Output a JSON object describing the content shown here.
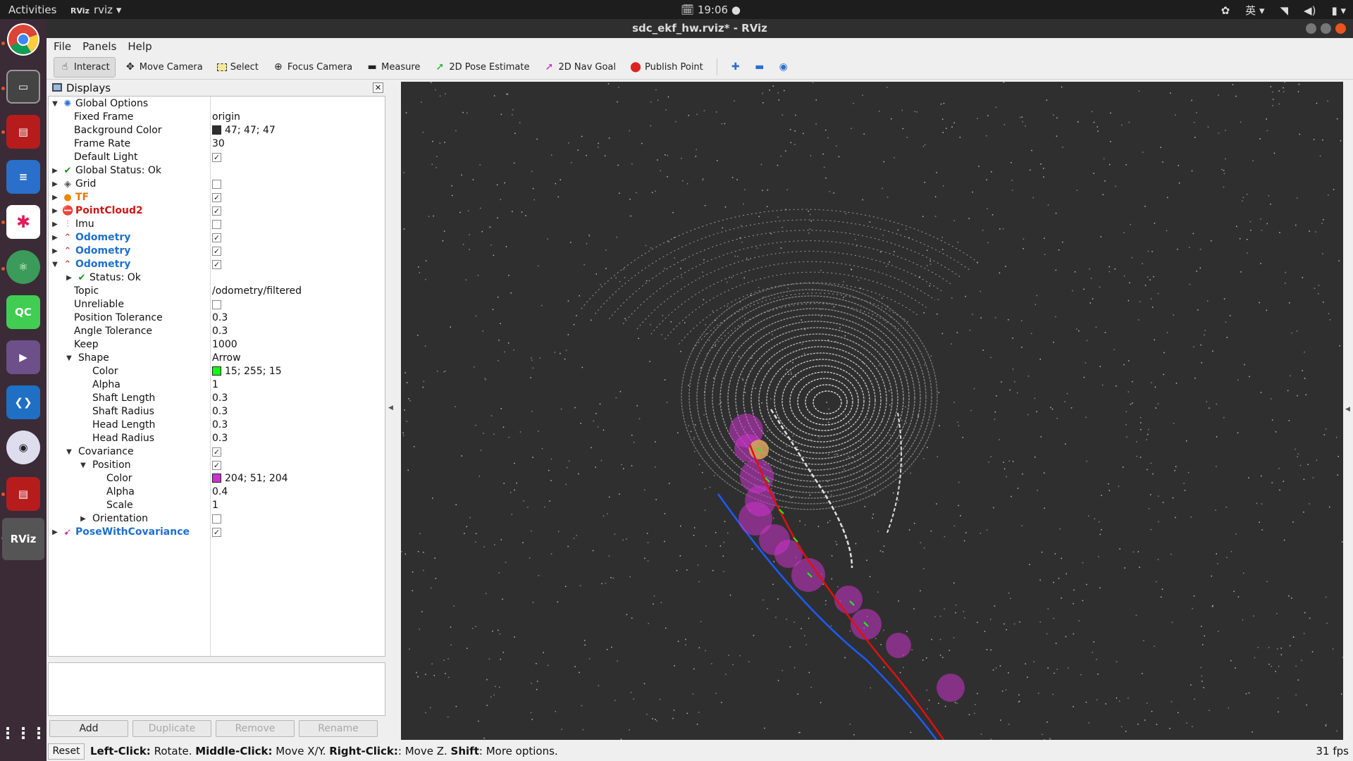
{
  "topbar": {
    "activities": "Activities",
    "app_name": "rviz",
    "app_icon_text": "RViz",
    "clock": "19:06",
    "ime": "英"
  },
  "window": {
    "title": "sdc_ekf_hw.rviz* - RViz"
  },
  "menu": {
    "file": "File",
    "panels": "Panels",
    "help": "Help"
  },
  "toolbar": {
    "interact": "Interact",
    "move_camera": "Move Camera",
    "select": "Select",
    "focus_camera": "Focus Camera",
    "measure": "Measure",
    "pose_estimate": "2D Pose Estimate",
    "nav_goal": "2D Nav Goal",
    "publish_point": "Publish Point"
  },
  "displays": {
    "title": "Displays",
    "rows": [
      {
        "name": "Global Options",
        "value": ""
      },
      {
        "name": "Fixed Frame",
        "value": "origin"
      },
      {
        "name": "Background Color",
        "value": "47; 47; 47"
      },
      {
        "name": "Frame Rate",
        "value": "30"
      },
      {
        "name": "Default Light",
        "value": ""
      },
      {
        "name": "Global Status: Ok",
        "value": ""
      },
      {
        "name": "Grid",
        "value": ""
      },
      {
        "name": "TF",
        "value": ""
      },
      {
        "name": "PointCloud2",
        "value": ""
      },
      {
        "name": "Imu",
        "value": ""
      },
      {
        "name": "Odometry",
        "value": ""
      },
      {
        "name": "Odometry",
        "value": ""
      },
      {
        "name": "Odometry",
        "value": ""
      },
      {
        "name": "Status: Ok",
        "value": ""
      },
      {
        "name": "Topic",
        "value": "/odometry/filtered"
      },
      {
        "name": "Unreliable",
        "value": ""
      },
      {
        "name": "Position Tolerance",
        "value": "0.3"
      },
      {
        "name": "Angle Tolerance",
        "value": "0.3"
      },
      {
        "name": "Keep",
        "value": "1000"
      },
      {
        "name": "Shape",
        "value": "Arrow"
      },
      {
        "name": "Color",
        "value": "15; 255; 15"
      },
      {
        "name": "Alpha",
        "value": "1"
      },
      {
        "name": "Shaft Length",
        "value": "0.3"
      },
      {
        "name": "Shaft Radius",
        "value": "0.3"
      },
      {
        "name": "Head Length",
        "value": "0.3"
      },
      {
        "name": "Head Radius",
        "value": "0.3"
      },
      {
        "name": "Covariance",
        "value": ""
      },
      {
        "name": "Position",
        "value": ""
      },
      {
        "name": "Color",
        "value": "204; 51; 204"
      },
      {
        "name": "Alpha",
        "value": "0.4"
      },
      {
        "name": "Scale",
        "value": "1"
      },
      {
        "name": "Orientation",
        "value": ""
      },
      {
        "name": "PoseWithCovariance",
        "value": ""
      }
    ],
    "buttons": {
      "add": "Add",
      "duplicate": "Duplicate",
      "remove": "Remove",
      "rename": "Rename"
    }
  },
  "colors": {
    "background": "#2f2f2f",
    "arrow_color": "#0fff0f",
    "covariance_color": "#cc33cc",
    "path_red": "#e01010",
    "path_blue": "#1a5cff"
  },
  "status": {
    "reset": "Reset",
    "k1": "Left-Click:",
    "v1": " Rotate. ",
    "k2": "Middle-Click:",
    "v2": " Move X/Y. ",
    "k3": "Right-Click:",
    "v3": ": Move Z. ",
    "k4": "Shift",
    "v4": ": More options.",
    "fps": "31 fps"
  }
}
